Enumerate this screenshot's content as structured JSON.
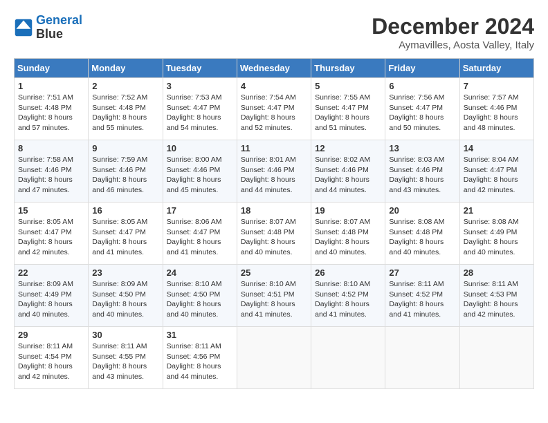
{
  "logo": {
    "line1": "General",
    "line2": "Blue"
  },
  "title": "December 2024",
  "location": "Aymavilles, Aosta Valley, Italy",
  "days_of_week": [
    "Sunday",
    "Monday",
    "Tuesday",
    "Wednesday",
    "Thursday",
    "Friday",
    "Saturday"
  ],
  "weeks": [
    [
      {
        "day": "1",
        "sunrise": "7:51 AM",
        "sunset": "4:48 PM",
        "daylight": "8 hours and 57 minutes."
      },
      {
        "day": "2",
        "sunrise": "7:52 AM",
        "sunset": "4:48 PM",
        "daylight": "8 hours and 55 minutes."
      },
      {
        "day": "3",
        "sunrise": "7:53 AM",
        "sunset": "4:47 PM",
        "daylight": "8 hours and 54 minutes."
      },
      {
        "day": "4",
        "sunrise": "7:54 AM",
        "sunset": "4:47 PM",
        "daylight": "8 hours and 52 minutes."
      },
      {
        "day": "5",
        "sunrise": "7:55 AM",
        "sunset": "4:47 PM",
        "daylight": "8 hours and 51 minutes."
      },
      {
        "day": "6",
        "sunrise": "7:56 AM",
        "sunset": "4:47 PM",
        "daylight": "8 hours and 50 minutes."
      },
      {
        "day": "7",
        "sunrise": "7:57 AM",
        "sunset": "4:46 PM",
        "daylight": "8 hours and 48 minutes."
      }
    ],
    [
      {
        "day": "8",
        "sunrise": "7:58 AM",
        "sunset": "4:46 PM",
        "daylight": "8 hours and 47 minutes."
      },
      {
        "day": "9",
        "sunrise": "7:59 AM",
        "sunset": "4:46 PM",
        "daylight": "8 hours and 46 minutes."
      },
      {
        "day": "10",
        "sunrise": "8:00 AM",
        "sunset": "4:46 PM",
        "daylight": "8 hours and 45 minutes."
      },
      {
        "day": "11",
        "sunrise": "8:01 AM",
        "sunset": "4:46 PM",
        "daylight": "8 hours and 44 minutes."
      },
      {
        "day": "12",
        "sunrise": "8:02 AM",
        "sunset": "4:46 PM",
        "daylight": "8 hours and 44 minutes."
      },
      {
        "day": "13",
        "sunrise": "8:03 AM",
        "sunset": "4:46 PM",
        "daylight": "8 hours and 43 minutes."
      },
      {
        "day": "14",
        "sunrise": "8:04 AM",
        "sunset": "4:47 PM",
        "daylight": "8 hours and 42 minutes."
      }
    ],
    [
      {
        "day": "15",
        "sunrise": "8:05 AM",
        "sunset": "4:47 PM",
        "daylight": "8 hours and 42 minutes."
      },
      {
        "day": "16",
        "sunrise": "8:05 AM",
        "sunset": "4:47 PM",
        "daylight": "8 hours and 41 minutes."
      },
      {
        "day": "17",
        "sunrise": "8:06 AM",
        "sunset": "4:47 PM",
        "daylight": "8 hours and 41 minutes."
      },
      {
        "day": "18",
        "sunrise": "8:07 AM",
        "sunset": "4:48 PM",
        "daylight": "8 hours and 40 minutes."
      },
      {
        "day": "19",
        "sunrise": "8:07 AM",
        "sunset": "4:48 PM",
        "daylight": "8 hours and 40 minutes."
      },
      {
        "day": "20",
        "sunrise": "8:08 AM",
        "sunset": "4:48 PM",
        "daylight": "8 hours and 40 minutes."
      },
      {
        "day": "21",
        "sunrise": "8:08 AM",
        "sunset": "4:49 PM",
        "daylight": "8 hours and 40 minutes."
      }
    ],
    [
      {
        "day": "22",
        "sunrise": "8:09 AM",
        "sunset": "4:49 PM",
        "daylight": "8 hours and 40 minutes."
      },
      {
        "day": "23",
        "sunrise": "8:09 AM",
        "sunset": "4:50 PM",
        "daylight": "8 hours and 40 minutes."
      },
      {
        "day": "24",
        "sunrise": "8:10 AM",
        "sunset": "4:50 PM",
        "daylight": "8 hours and 40 minutes."
      },
      {
        "day": "25",
        "sunrise": "8:10 AM",
        "sunset": "4:51 PM",
        "daylight": "8 hours and 41 minutes."
      },
      {
        "day": "26",
        "sunrise": "8:10 AM",
        "sunset": "4:52 PM",
        "daylight": "8 hours and 41 minutes."
      },
      {
        "day": "27",
        "sunrise": "8:11 AM",
        "sunset": "4:52 PM",
        "daylight": "8 hours and 41 minutes."
      },
      {
        "day": "28",
        "sunrise": "8:11 AM",
        "sunset": "4:53 PM",
        "daylight": "8 hours and 42 minutes."
      }
    ],
    [
      {
        "day": "29",
        "sunrise": "8:11 AM",
        "sunset": "4:54 PM",
        "daylight": "8 hours and 42 minutes."
      },
      {
        "day": "30",
        "sunrise": "8:11 AM",
        "sunset": "4:55 PM",
        "daylight": "8 hours and 43 minutes."
      },
      {
        "day": "31",
        "sunrise": "8:11 AM",
        "sunset": "4:56 PM",
        "daylight": "8 hours and 44 minutes."
      },
      null,
      null,
      null,
      null
    ]
  ]
}
